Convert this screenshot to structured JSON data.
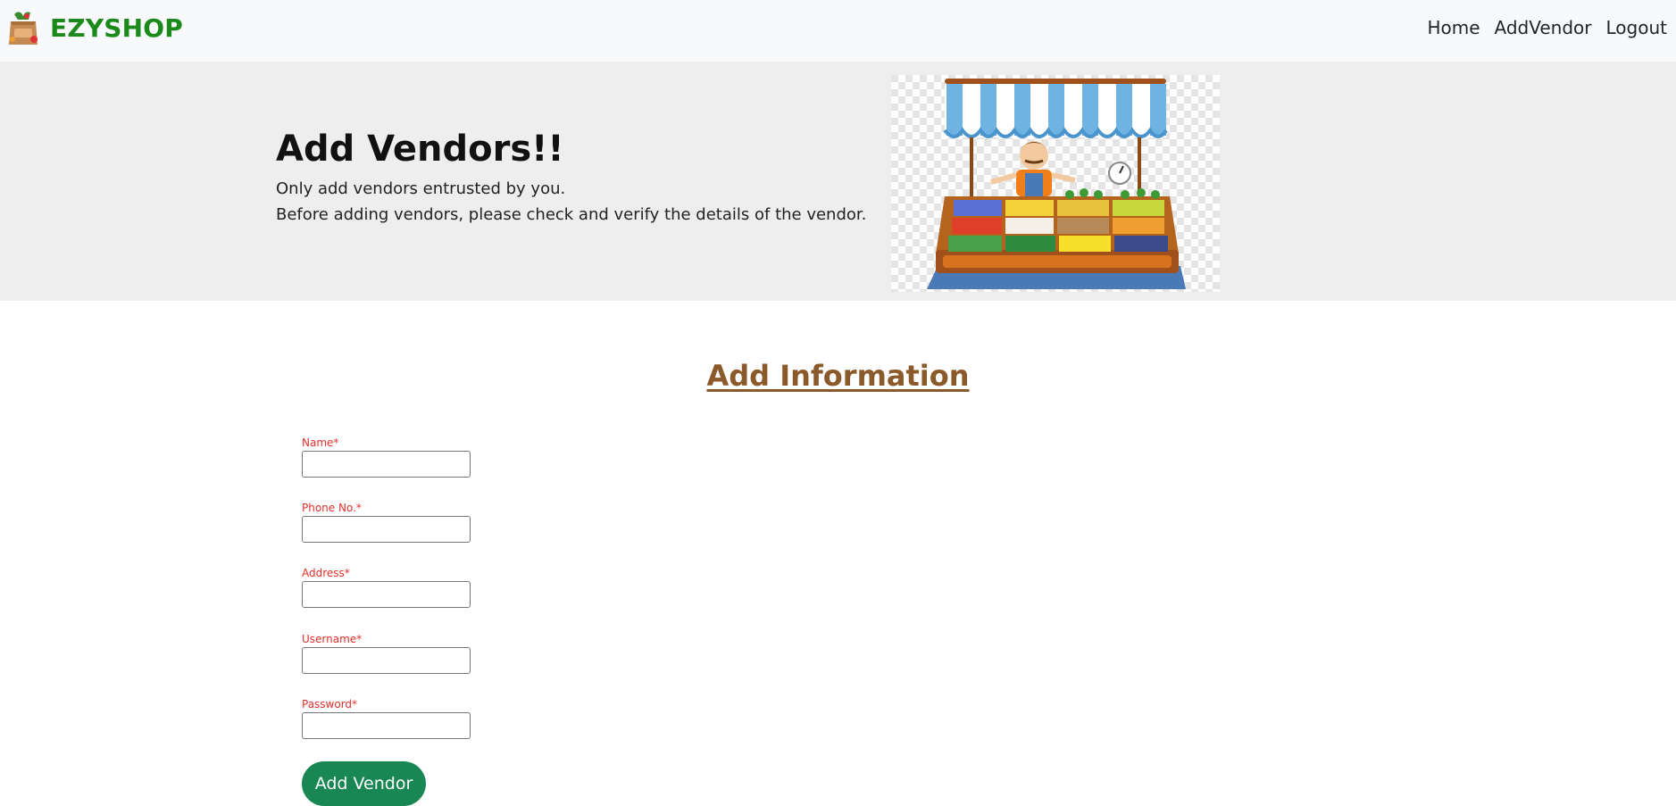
{
  "navbar": {
    "brand_name": "EZYSHOP",
    "brand_icon": "grocery-bag-icon",
    "links": [
      {
        "label": "Home"
      },
      {
        "label": "AddVendor"
      },
      {
        "label": "Logout"
      }
    ]
  },
  "hero": {
    "title": "Add Vendors!!",
    "line1": "Only add vendors entrusted by you.",
    "line2": "Before adding vendors, please check and verify the details of the vendor.",
    "image": "vendor-market-stall-illustration"
  },
  "form": {
    "heading": "Add Information",
    "fields": [
      {
        "label": "Name*",
        "value": "",
        "placeholder": ""
      },
      {
        "label": "Phone No.*",
        "value": "",
        "placeholder": ""
      },
      {
        "label": "Address*",
        "value": "",
        "placeholder": ""
      },
      {
        "label": "Username*",
        "value": "",
        "placeholder": ""
      },
      {
        "label": "Password*",
        "value": "",
        "placeholder": ""
      }
    ],
    "submit_label": "Add Vendor"
  },
  "colors": {
    "brand": "#1b8a1b",
    "heading": "#8b5a2b",
    "required_label": "#e0302a",
    "button": "#198754",
    "navbar_bg": "#f8f9fa",
    "hero_bg": "#eeeeee"
  }
}
